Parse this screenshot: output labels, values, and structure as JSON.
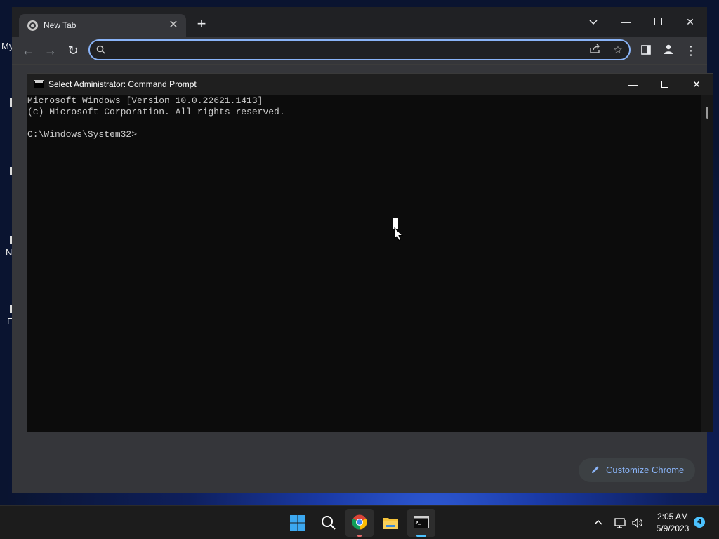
{
  "desktop": {
    "fragments": [
      "My",
      "N",
      "E"
    ]
  },
  "chrome": {
    "tab_title": "New Tab",
    "omnibox": {
      "value": "",
      "placeholder": ""
    },
    "customize_label": "Customize Chrome",
    "colors": {
      "accent": "#8ab4f8",
      "frame": "#202124",
      "toolbar": "#35363a"
    }
  },
  "cmd": {
    "title": "Select Administrator:  Command Prompt",
    "lines": [
      "Microsoft Windows [Version 10.0.22621.1413]",
      "(c) Microsoft Corporation. All rights reserved.",
      "",
      "C:\\Windows\\System32>"
    ]
  },
  "taskbar": {
    "apps": [
      "start-icon",
      "search-icon",
      "chrome-icon",
      "file-explorer-icon",
      "command-prompt-icon"
    ],
    "time": "2:05 AM",
    "date": "5/9/2023",
    "notification_count": "4"
  }
}
